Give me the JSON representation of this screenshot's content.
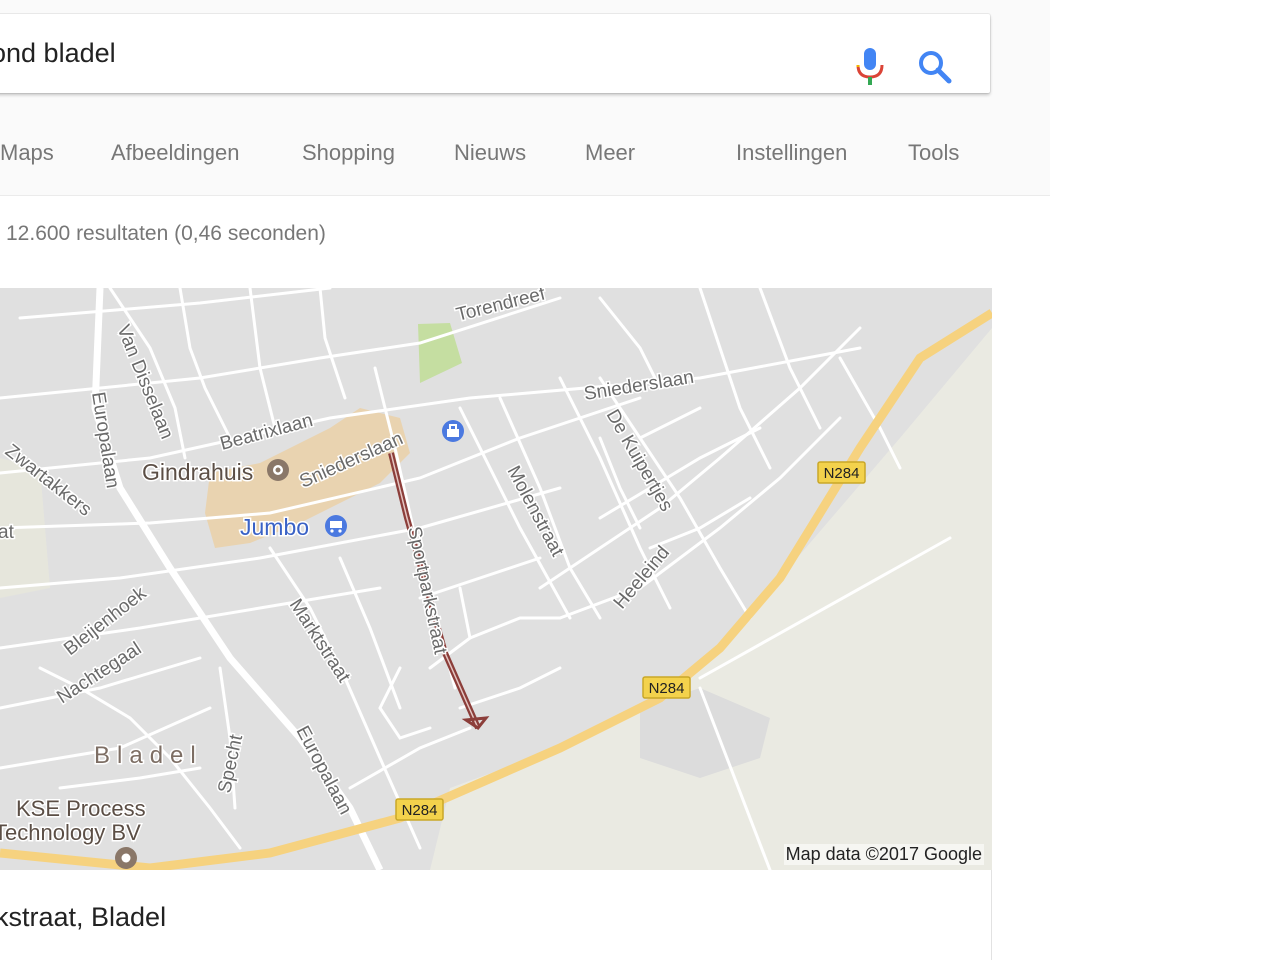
{
  "search": {
    "query": "ond bladel"
  },
  "nav": {
    "tabs": [
      {
        "label": "Maps"
      },
      {
        "label": "Afbeeldingen"
      },
      {
        "label": "Shopping"
      },
      {
        "label": "Nieuws"
      },
      {
        "label": "Meer"
      }
    ],
    "settings": "Instellingen",
    "tools": "Tools"
  },
  "results": {
    "stats": "12.600 resultaten (0,46 seconden)"
  },
  "map": {
    "streets": [
      "Torendreef",
      "Van Disselaan",
      "Europalaan",
      "Beatrixlaan",
      "Zwartakkers",
      "Sniederslaan",
      "Sniederslaan",
      "De Kuipertjes",
      "Molenstraat",
      "Sportparkstraat",
      "Heeleind",
      "Bleijenhoek",
      "Nachtegaal",
      "Marktstraat",
      "Specht",
      "Europalaan",
      "at"
    ],
    "places": [
      "Gindrahuis",
      "Jumbo",
      "KSE Process",
      "Technology BV"
    ],
    "town": "Bladel",
    "route_shields": [
      "N284",
      "N284",
      "N284"
    ],
    "attribution": "Map data ©2017 Google",
    "colors": {
      "highway": "#f6d27f",
      "park": "#c5dea1",
      "commercial": "#e9d3b0",
      "rural": "#eaeae2",
      "highlight": "#8c3e3a",
      "poi_blue": "#4b79e0",
      "poi_brown": "#8a7768"
    }
  },
  "result": {
    "title": "rkstraat, Bladel"
  }
}
